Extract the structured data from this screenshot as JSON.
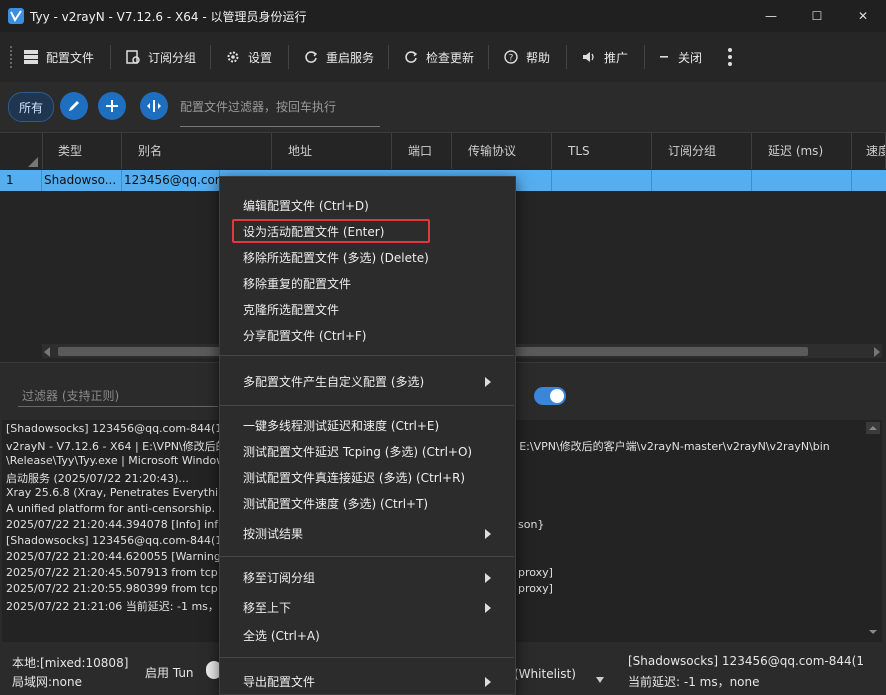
{
  "window": {
    "title": "Tyy - v2rayN - V7.12.6 - X64 - 以管理员身份运行",
    "controls": {
      "minimize": "—",
      "maximize": "☐",
      "close": "✕"
    }
  },
  "toolbar": {
    "items": [
      {
        "label": "配置文件",
        "icon": "grid-icon"
      },
      {
        "label": "订阅分组",
        "icon": "subscription-icon"
      },
      {
        "label": "设置",
        "icon": "gear-icon"
      },
      {
        "label": "重启服务",
        "icon": "restart-icon"
      },
      {
        "label": "检查更新",
        "icon": "update-icon"
      },
      {
        "label": "帮助",
        "icon": "help-icon"
      },
      {
        "label": "推广",
        "icon": "speaker-icon"
      },
      {
        "label": "关闭",
        "icon": "minus-icon"
      }
    ]
  },
  "filter_bar": {
    "all_label": "所有",
    "placeholder": "配置文件过滤器，按回车执行"
  },
  "grid": {
    "columns": [
      "类型",
      "别名",
      "地址",
      "端口",
      "传输协议",
      "TLS",
      "订阅分组",
      "延迟 (ms)",
      "速度"
    ],
    "rows": [
      {
        "index": "1",
        "type": "Shadowso...",
        "alias": "123456@qq.com"
      }
    ]
  },
  "log": {
    "filter_placeholder": "过滤器 (支持正则)",
    "lines": [
      "[Shadowsocks] 123456@qq.com-844(183",
      "v2rayN - V7.12.6 - X64 | E:\\VPN\\修改后的",
      "\\Release\\Tyy\\Tyy.exe | Microsoft Window",
      "启动服务 (2025/07/22 21:20:43)...",
      "Xray 25.6.8 (Xray, Penetrates Everything.)",
      "A unified platform for anti-censorship.",
      "2025/07/22 21:20:44.394078 [Info] infra/c",
      "[Shadowsocks] 123456@qq.com-844(183",
      "2025/07/22 21:20:44.620055 [Warning] cc",
      "2025/07/22 21:20:45.507913 from tcp:127",
      "2025/07/22 21:20:55.980399 from tcp:127",
      "2025/07/22 21:21:06 当前延迟: -1 ms，no"
    ],
    "right_fragments": [
      "| E:\\VPN\\修改后的客户端\\v2rayN-master\\v2rayN\\v2rayN\\bin",
      "son}",
      "proxy]",
      "proxy]"
    ]
  },
  "status_bar": {
    "local": "本地:[mixed:10808]",
    "lan": "局域网:none",
    "tun_label": "启用 Tun",
    "routing": "(Whitelist)",
    "server": "[Shadowsocks] 123456@qq.com-844(1",
    "latency": "当前延迟: -1 ms，none"
  },
  "context_menu": {
    "items": [
      {
        "label": "编辑配置文件 (Ctrl+D)"
      },
      {
        "label": "设为活动配置文件 (Enter)"
      },
      {
        "label": "移除所选配置文件 (多选) (Delete)"
      },
      {
        "label": "移除重复的配置文件"
      },
      {
        "label": "克隆所选配置文件"
      },
      {
        "label": "分享配置文件 (Ctrl+F)"
      },
      {
        "label": "多配置文件产生自定义配置 (多选)"
      },
      {
        "label": "一键多线程测试延迟和速度 (Ctrl+E)"
      },
      {
        "label": "测试配置文件延迟 Tcping (多选) (Ctrl+O)"
      },
      {
        "label": "测试配置文件真连接延迟 (多选) (Ctrl+R)"
      },
      {
        "label": "测试配置文件速度 (多选) (Ctrl+T)"
      },
      {
        "label": "按测试结果"
      },
      {
        "label": "移至订阅分组"
      },
      {
        "label": "移至上下"
      },
      {
        "label": "全选 (Ctrl+A)"
      },
      {
        "label": "导出配置文件"
      }
    ]
  },
  "colors": {
    "accent": "#1e6fbf",
    "selected_row": "#55aef0",
    "highlight_border": "#e0393e"
  }
}
